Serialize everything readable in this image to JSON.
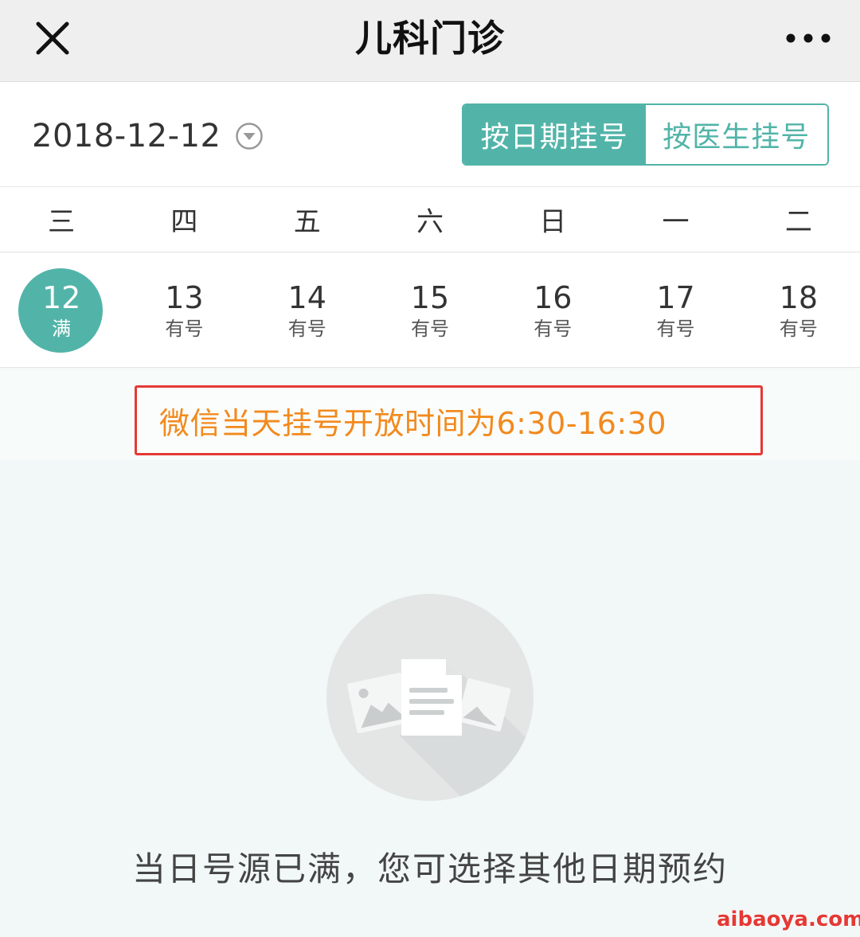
{
  "header": {
    "title": "儿科门诊",
    "close_icon": "close-icon",
    "more_icon": "more-dots-icon"
  },
  "date_selector": {
    "selected_date": "2018-12-12",
    "dropdown_icon": "chevron-down-circle-icon"
  },
  "mode_switch": {
    "by_date_label": "按日期挂号",
    "by_doctor_label": "按医生挂号",
    "active": "by_date"
  },
  "weekdays": [
    "三",
    "四",
    "五",
    "六",
    "日",
    "一",
    "二"
  ],
  "days": [
    {
      "num": "12",
      "status": "满",
      "selected": true
    },
    {
      "num": "13",
      "status": "有号",
      "selected": false
    },
    {
      "num": "14",
      "status": "有号",
      "selected": false
    },
    {
      "num": "15",
      "status": "有号",
      "selected": false
    },
    {
      "num": "16",
      "status": "有号",
      "selected": false
    },
    {
      "num": "17",
      "status": "有号",
      "selected": false
    },
    {
      "num": "18",
      "status": "有号",
      "selected": false
    }
  ],
  "notice": {
    "text": "微信当天挂号开放时间为6:30-16:30"
  },
  "empty_state": {
    "icon": "empty-document-icon",
    "message": "当日号源已满，您可选择其他日期预约"
  },
  "watermark": {
    "text": "aibaoya.com"
  },
  "colors": {
    "accent": "#52b4a8",
    "notice_text": "#f28a1e",
    "notice_border": "#e53935"
  }
}
